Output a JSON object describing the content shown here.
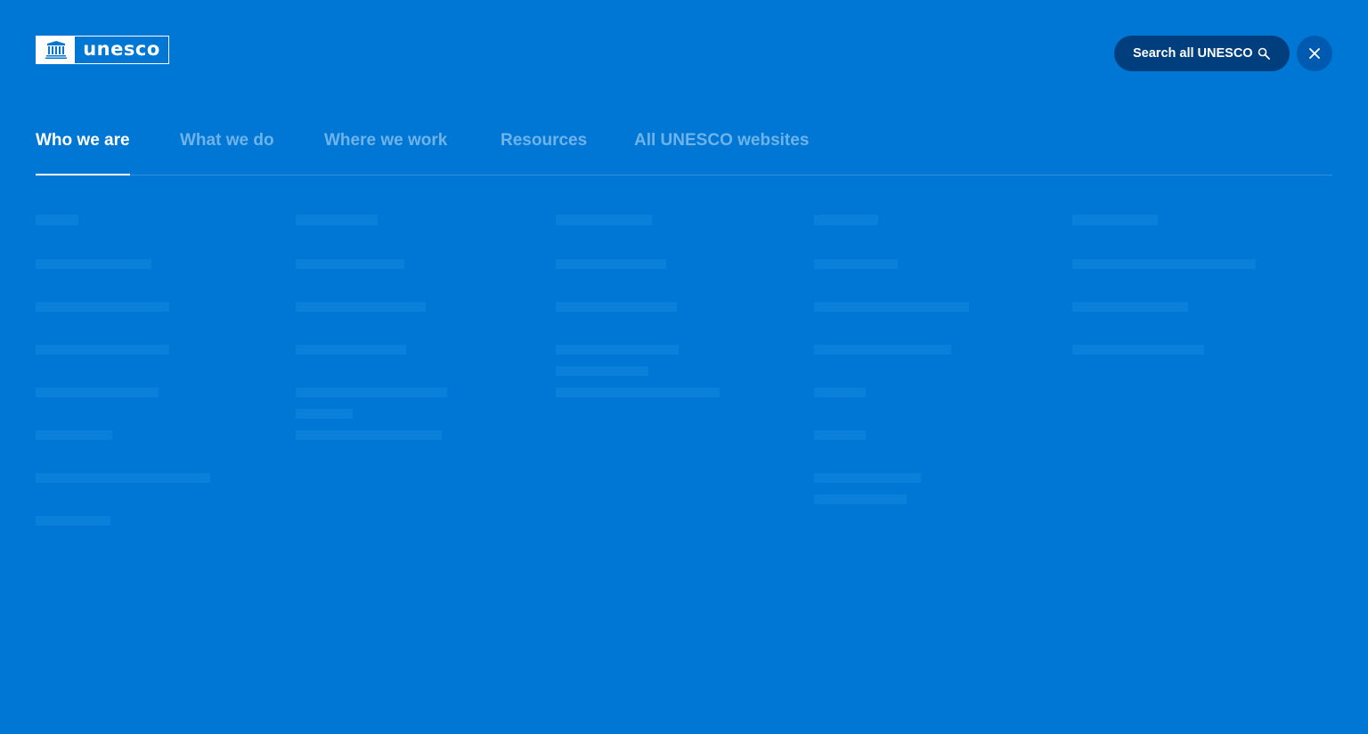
{
  "header": {
    "logo_text": "unesco",
    "search_label": "Search all UNESCO",
    "search_icon": "search-icon",
    "close_icon": "close-icon"
  },
  "tabs": [
    {
      "label": "Who we are",
      "active": true
    },
    {
      "label": "What we do",
      "active": false
    },
    {
      "label": "Where we work",
      "active": false
    },
    {
      "label": "Resources",
      "active": false
    },
    {
      "label": "All UNESCO websites",
      "active": false
    }
  ],
  "colors": {
    "background": "#0077d4",
    "search_pill": "#003e7e",
    "close_button": "#005bb0",
    "inactive_tab": "#6eb3ea",
    "active_tab": "#ffffff"
  }
}
